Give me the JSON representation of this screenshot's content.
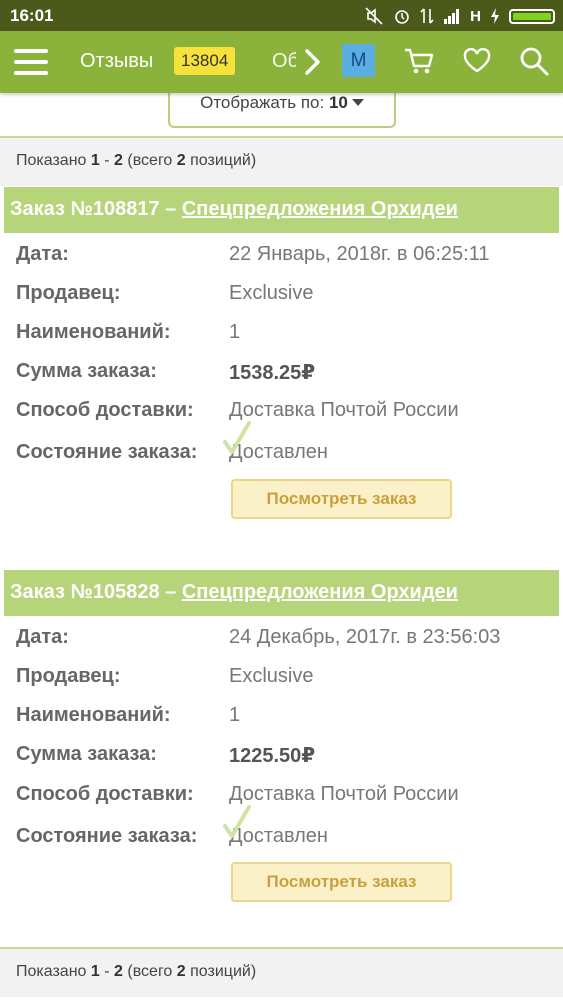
{
  "status_bar": {
    "time": "16:01",
    "network_label": "H",
    "icons": [
      "mute-icon",
      "alarm-icon",
      "data-transfer-icon",
      "signal-icon",
      "charging-icon",
      "battery-icon"
    ]
  },
  "topbar": {
    "menu_icon": "hamburger-icon",
    "reviews_label": "Отзывы",
    "reviews_count": "13804",
    "next_tab_label": "Об",
    "user_initial": "М",
    "colors": {
      "bar": "#8bb33b",
      "badge": "#f6e23a",
      "avatar": "#5aaee0"
    }
  },
  "perpage": {
    "label": "Отображать по:",
    "value": "10"
  },
  "pagination_top": {
    "prefix": "Показано",
    "from": "1",
    "dash": "-",
    "to": "2",
    "total_prefix": "(всего",
    "total": "2",
    "total_suffix": "позиций)"
  },
  "pagination_bottom": {
    "prefix": "Показано",
    "from": "1",
    "dash": "-",
    "to": "2",
    "total_prefix": "(всего",
    "total": "2",
    "total_suffix": "позиций)"
  },
  "labels": {
    "date": "Дата:",
    "seller": "Продавец:",
    "items": "Наименований:",
    "sum": "Сумма заказа:",
    "delivery": "Способ доставки:",
    "state": "Состояние заказа:",
    "view_button": "Посмотреть заказ"
  },
  "orders": [
    {
      "title": "Заказ №108817 –",
      "store": "Спецпредложения Орхидеи",
      "date": "22 Январь, 2018г. в 06:25:11",
      "seller": "Exclusive",
      "items": "1",
      "sum": "1538.25₽",
      "delivery": "Доставка Почтой России",
      "state": "Доставлен"
    },
    {
      "title": "Заказ №105828 –",
      "store": "Спецпредложения Орхидеи",
      "date": "24 Декабрь, 2017г. в 23:56:03",
      "seller": "Exclusive",
      "items": "1",
      "sum": "1225.50₽",
      "delivery": "Доставка Почтой России",
      "state": "Доставлен"
    }
  ]
}
